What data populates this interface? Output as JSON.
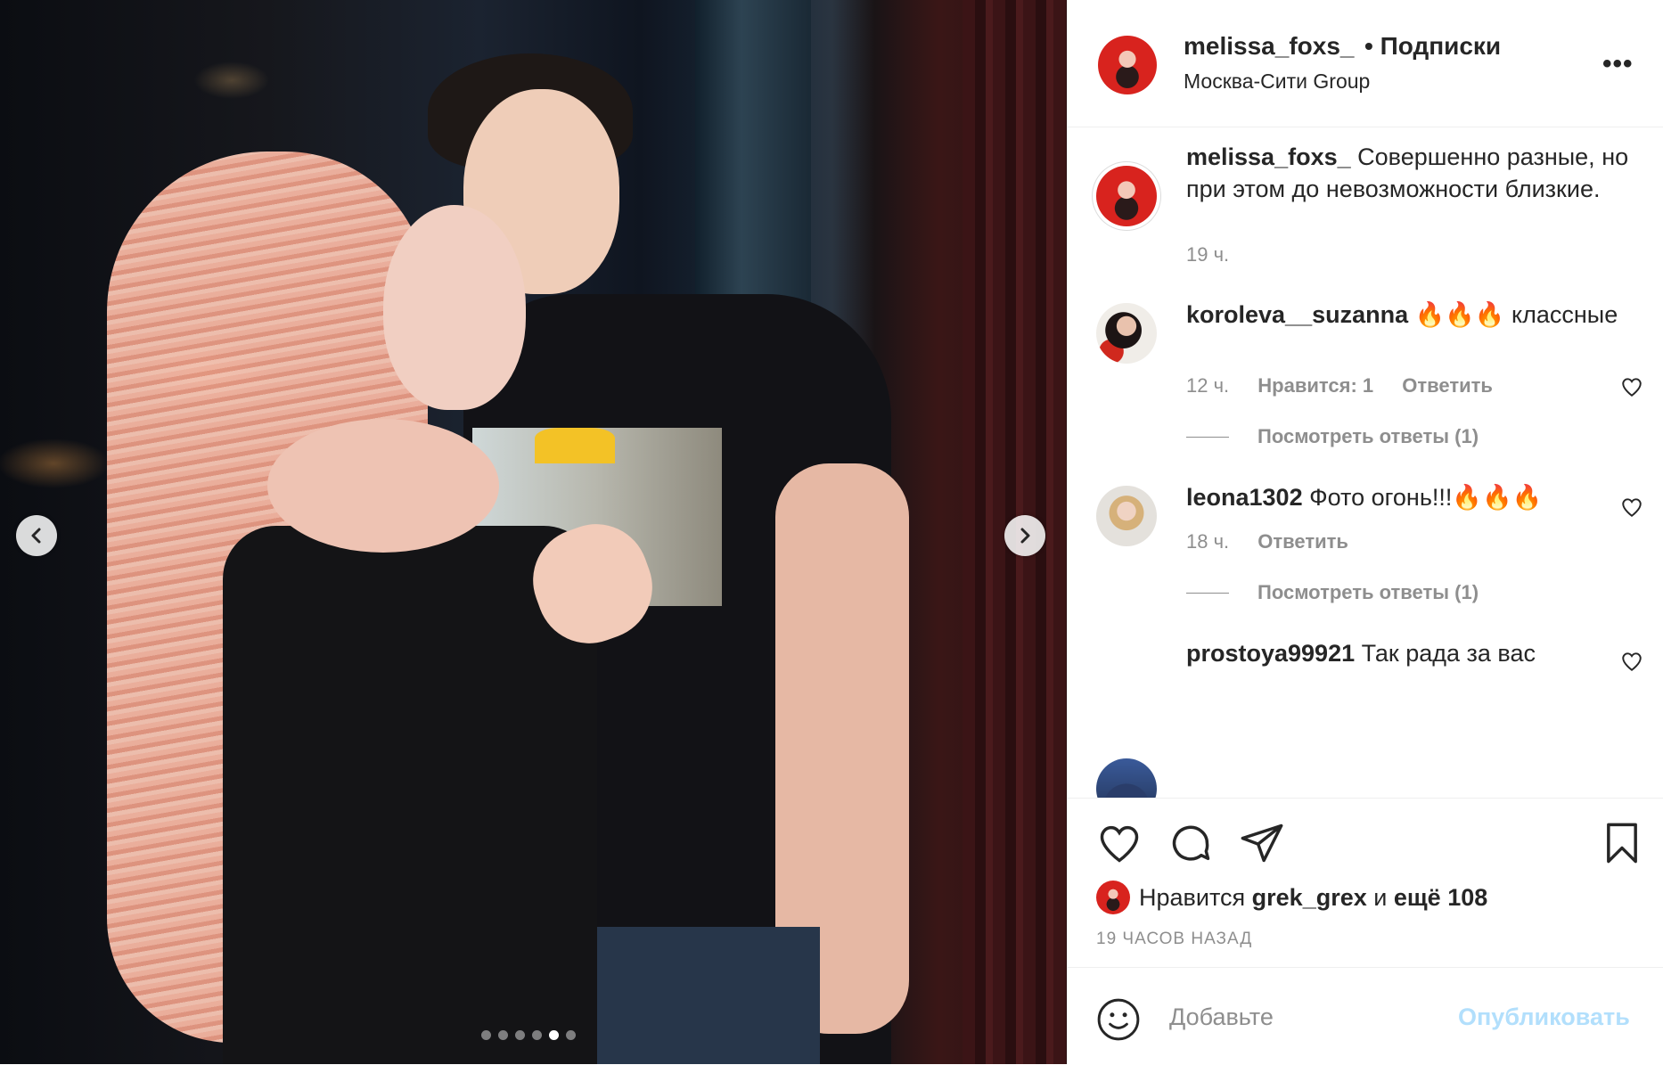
{
  "post": {
    "username": "melissa_foxs_",
    "follow_label": "• Подписки",
    "location": "Москва-Сити Group",
    "more_icon": "more-horizontal-icon",
    "caption": "Совершенно разные, но при этом до невозможности близкие.",
    "caption_time": "19 ч.",
    "carousel": {
      "slide_count": 6,
      "active_index": 4
    }
  },
  "comments": [
    {
      "user": "koroleva__suzanna",
      "text": "🔥🔥🔥 классные",
      "time": "12 ч.",
      "likes": "Нравится: 1",
      "reply": "Ответить",
      "view_replies": "Посмотреть ответы (1)"
    },
    {
      "user": "leona1302",
      "text": "Фото огонь!!!🔥🔥🔥",
      "time": "18 ч.",
      "reply": "Ответить",
      "view_replies": "Посмотреть ответы (1)"
    },
    {
      "user": "prostoya99921",
      "text": "Так рада за вас"
    }
  ],
  "likes": {
    "prefix": "Нравится",
    "user": "grek_grex",
    "and": "и",
    "others": "ещё 108"
  },
  "timestamp": "19 ЧАСОВ НАЗАД",
  "composer": {
    "placeholder": "Добавьте",
    "post_label": "Опубликовать"
  },
  "colors": {
    "post_button_disabled": "#b2dffc",
    "muted_text": "#8e8e8e",
    "primary_text": "#262626"
  }
}
